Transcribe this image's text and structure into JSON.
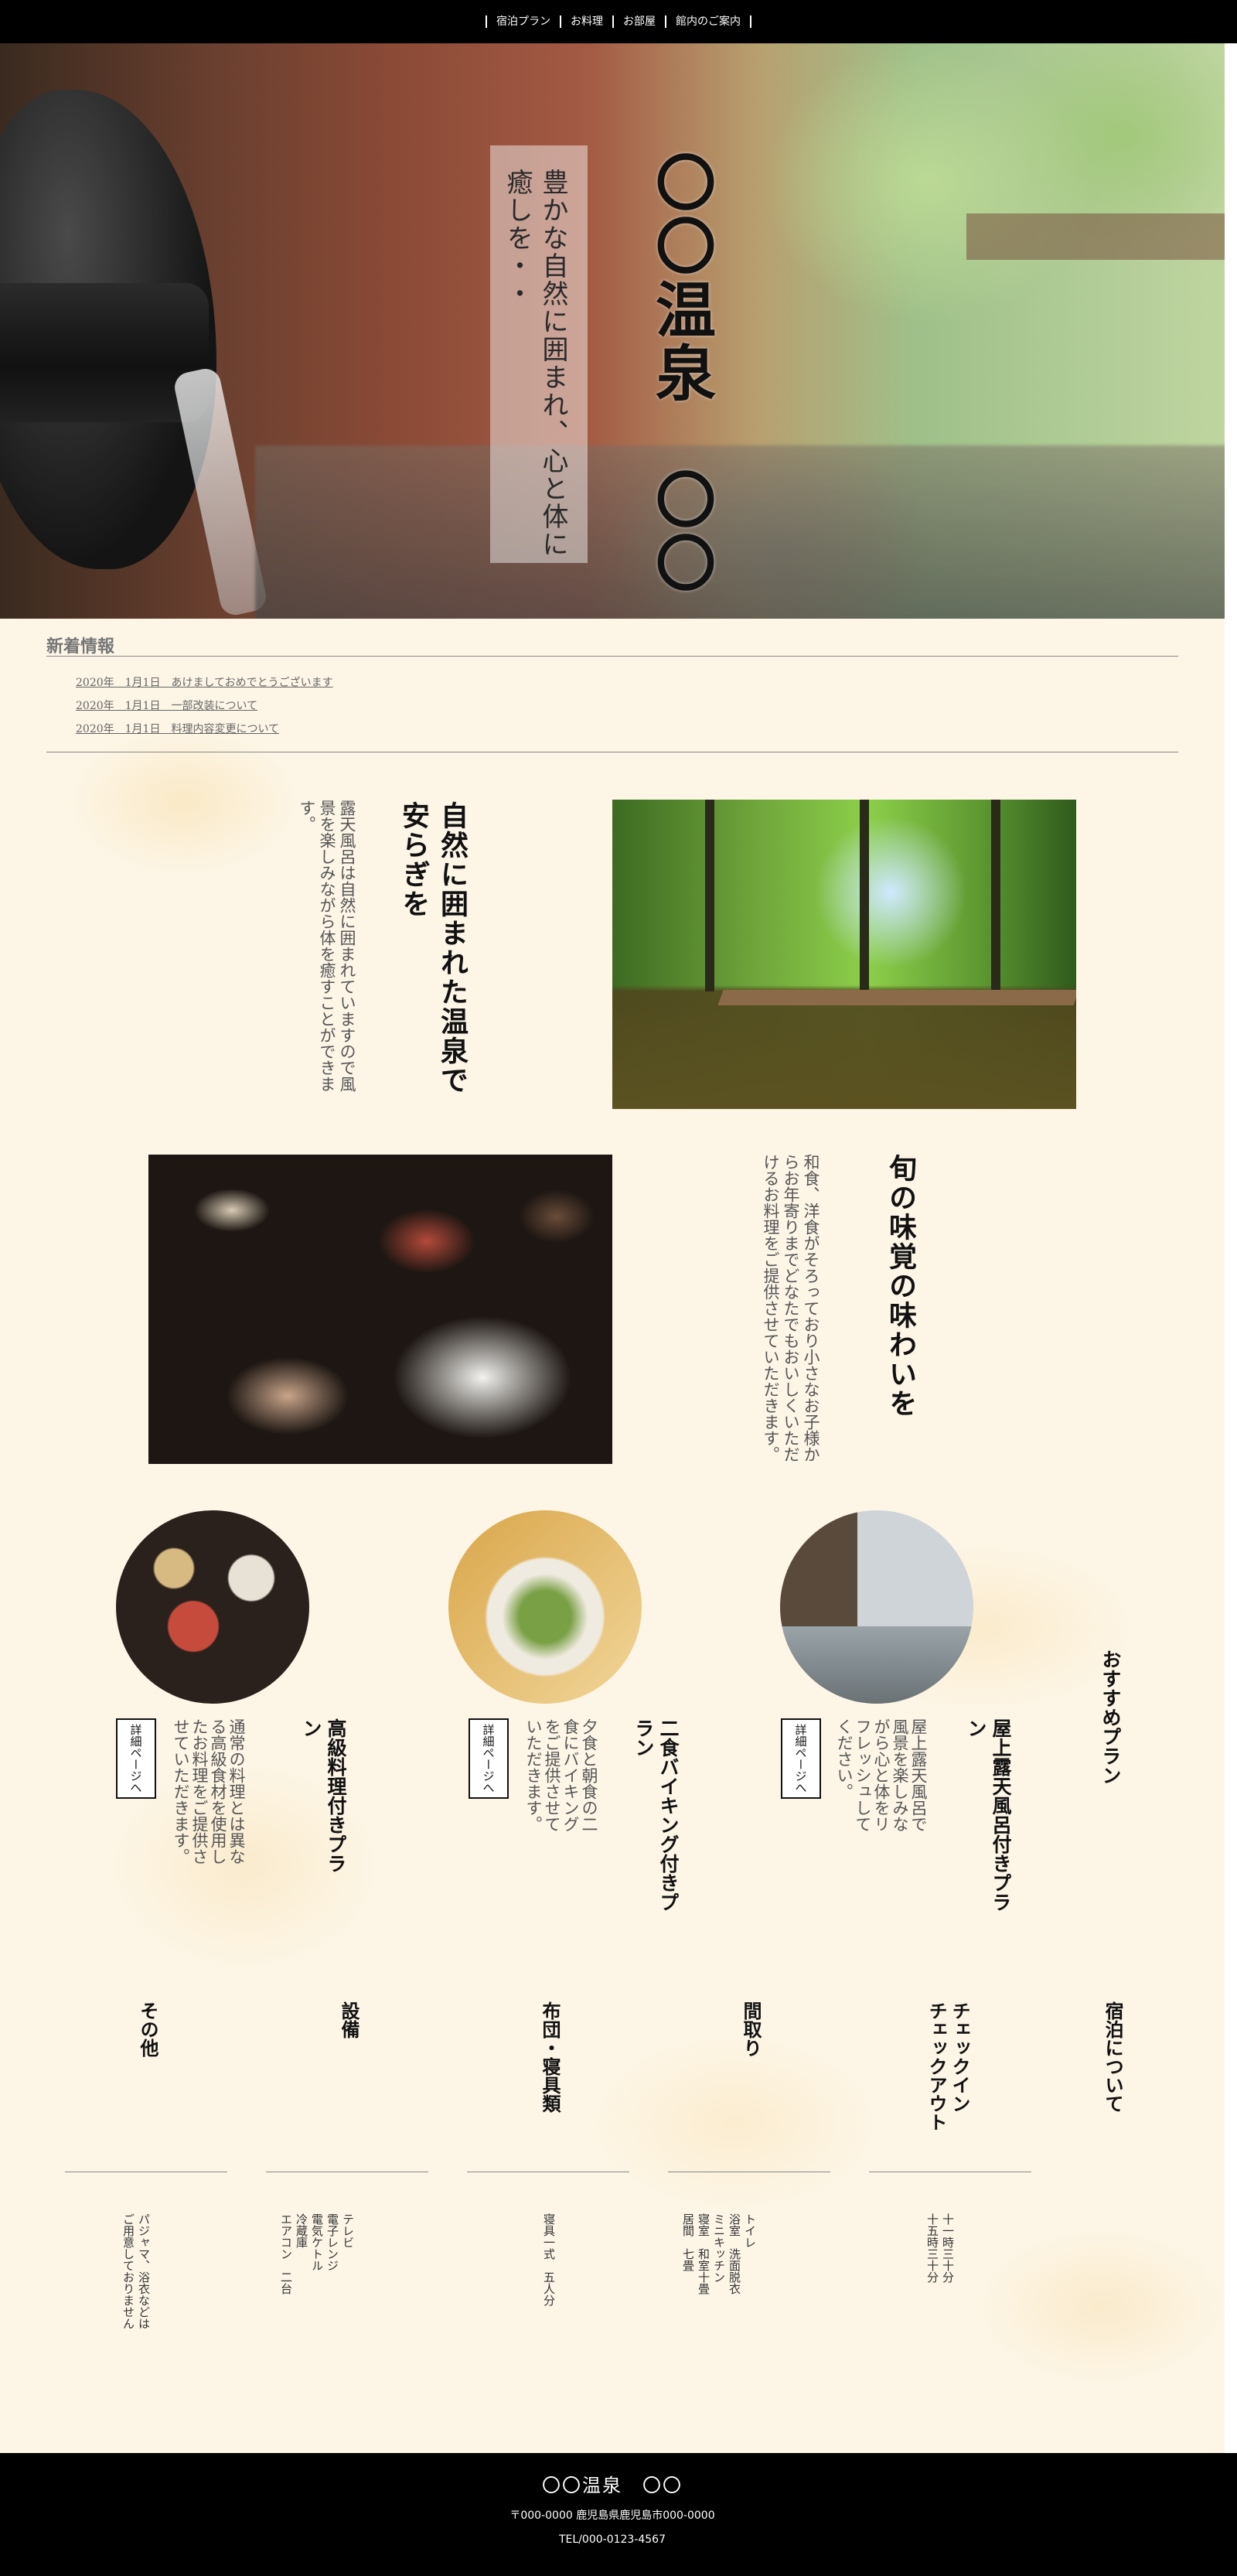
{
  "nav": {
    "items": [
      {
        "label": "宿泊プラン"
      },
      {
        "label": "お料理"
      },
      {
        "label": "お部屋"
      },
      {
        "label": "館内のご案内"
      }
    ]
  },
  "hero": {
    "catch": "豊かな自然に囲まれ、心と体に癒しを・・",
    "title": "〇〇温泉　〇〇"
  },
  "news": {
    "heading": "新着情報",
    "items": [
      {
        "text": "2020年　1月1日　あけましておめでとうございます"
      },
      {
        "text": "2020年　1月1日　一部改装について"
      },
      {
        "text": "2020年　1月1日　料理内容変更について"
      }
    ]
  },
  "feature1": {
    "heading": "自然に囲まれた温泉で安らぎを",
    "body": "露天風呂は自然に囲まれていますので風景を楽しみながら体を癒すことができます。"
  },
  "feature2": {
    "heading": "旬の味覚の味わいを",
    "body": "和食、洋食がそろっており小さなお子様からお年寄りまでどなたでもおいしくいただけるお料理をご提供させていただきます。"
  },
  "plans": {
    "heading": "おすすめプラン",
    "detail_label": "詳細ページへ",
    "items": [
      {
        "title": "高級料理付きプラン",
        "body": "通常の料理とは異なる高級食材を使用したお料理をご提供させていただきます。"
      },
      {
        "title": "二食バイキング付きプラン",
        "body": "夕食と朝食の二食にバイキングをご提供させていただきます。"
      },
      {
        "title": "屋上露天風呂付きプラン",
        "body": "屋上露天風呂で風景を楽しみながら心と体をリフレッシュしてください。"
      }
    ]
  },
  "info": {
    "heading": "宿泊について",
    "columns": [
      {
        "title": "チェックイン\nチェックアウト",
        "value": "十一時三十分\n十五時三十分"
      },
      {
        "title": "間取り",
        "value": "トイレ\n浴室　洗面脱衣\nミニキッチン\n寝室　和室十畳\n居間　七畳"
      },
      {
        "title": "布団・寝具類",
        "value": "寝具一式　五人分"
      },
      {
        "title": "設備",
        "value": "テレビ\n電子レンジ\n電気ケトル\n冷蔵庫\nエアコン　二台"
      },
      {
        "title": "その他",
        "value": "パジャマ、浴衣などは\nご用意しておりません"
      }
    ]
  },
  "footer": {
    "name": "〇〇温泉　〇〇",
    "address": "〒000-0000 鹿児島県鹿児島市000-0000",
    "tel": "TEL/000-0123-4567"
  }
}
